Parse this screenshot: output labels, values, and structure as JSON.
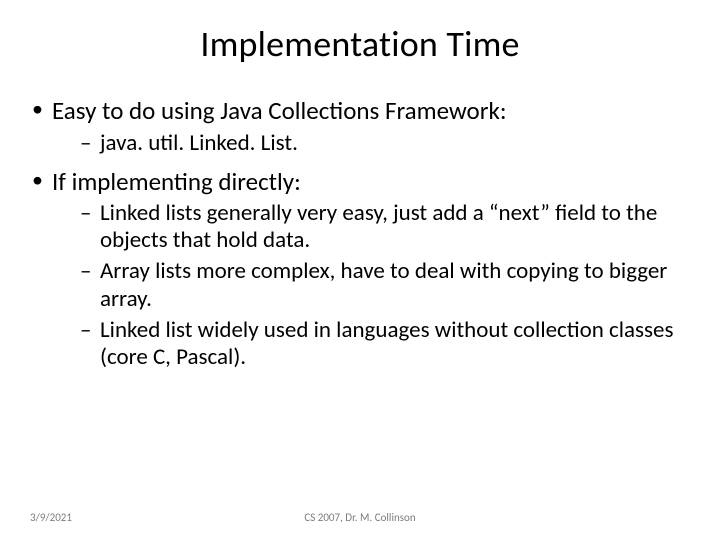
{
  "title": "Implementation Time",
  "bullets": [
    {
      "text": "Easy to do using Java Collections Framework:",
      "sub": [
        "java. util. Linked. List."
      ]
    },
    {
      "text": "If implementing directly:",
      "sub": [
        "Linked lists generally very easy, just add a “next” field to the objects that hold data.",
        "Array lists more complex, have to deal with copying to bigger array.",
        "Linked list widely used in languages without collection classes (core C, Pascal)."
      ]
    }
  ],
  "footer": {
    "date": "3/9/2021",
    "course": "CS 2007,  Dr. M. Collinson"
  }
}
